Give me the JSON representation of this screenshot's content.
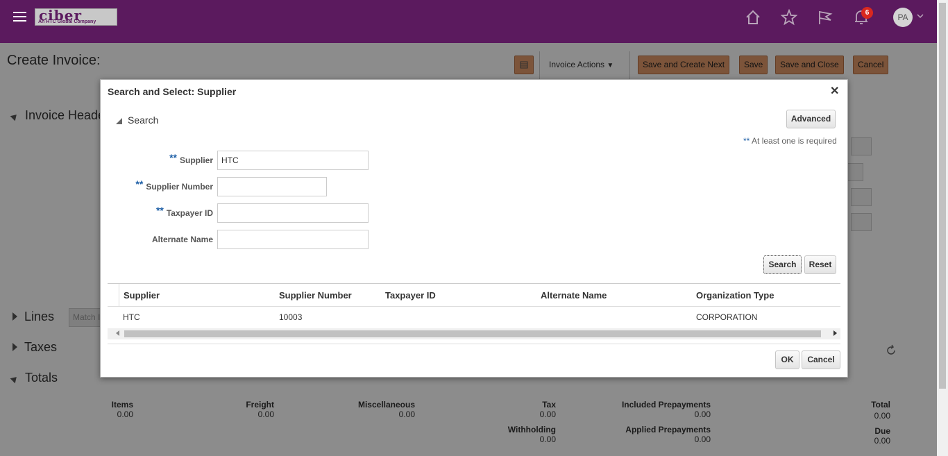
{
  "header": {
    "logo_text": "ciber",
    "logo_tagline": "An HTC Global Company",
    "notification_count": "6",
    "avatar_initials": "PA",
    "icons": [
      "hamburger-menu-icon",
      "home-icon",
      "star-icon",
      "flag-icon",
      "bell-icon",
      "chevron-down-icon"
    ]
  },
  "page": {
    "title": "Create Invoice:",
    "invoice_actions_label": "Invoice Actions",
    "buttons": {
      "save_and_create_next": "Save and Create Next",
      "save": "Save",
      "save_and_close": "Save and Close",
      "cancel": "Cancel"
    },
    "sections": {
      "invoice_header": "Invoice Heade",
      "lines": "Lines",
      "taxes": "Taxes",
      "totals": "Totals"
    },
    "match_label": "Match I",
    "totals": {
      "items_label": "Items",
      "items_value": "0.00",
      "freight_label": "Freight",
      "freight_value": "0.00",
      "misc_label": "Miscellaneous",
      "misc_value": "0.00",
      "tax_label": "Tax",
      "tax_value": "0.00",
      "included_prepay_label": "Included Prepayments",
      "included_prepay_value": "0.00",
      "total_label": "Total",
      "total_value": "0.00",
      "withholding_label": "Withholding",
      "withholding_value": "0.00",
      "applied_prepay_label": "Applied Prepayments",
      "applied_prepay_value": "0.00",
      "due_label": "Due",
      "due_value": "0.00"
    }
  },
  "dialog": {
    "title": "Search and Select: Supplier",
    "search_section_label": "Search",
    "advanced_button": "Advanced",
    "required_note": "At least one is required",
    "required_marker": "**",
    "fields": {
      "supplier_label": "Supplier",
      "supplier_value": "HTC",
      "supplier_number_label": "Supplier Number",
      "supplier_number_value": "",
      "taxpayer_id_label": "Taxpayer ID",
      "taxpayer_id_value": "",
      "alternate_name_label": "Alternate Name",
      "alternate_name_value": ""
    },
    "search_button": "Search",
    "reset_button": "Reset",
    "table": {
      "columns": [
        "Supplier",
        "Supplier Number",
        "Taxpayer ID",
        "Alternate Name",
        "Organization Type"
      ],
      "rows": [
        [
          "HTC",
          "10003",
          "",
          "",
          "CORPORATION"
        ]
      ]
    },
    "ok_button": "OK",
    "cancel_button": "Cancel"
  },
  "colors": {
    "header_bg": "#5b1a5e",
    "action_button_bg": "#e29a6b",
    "required_marker": "#1e5fa6"
  }
}
